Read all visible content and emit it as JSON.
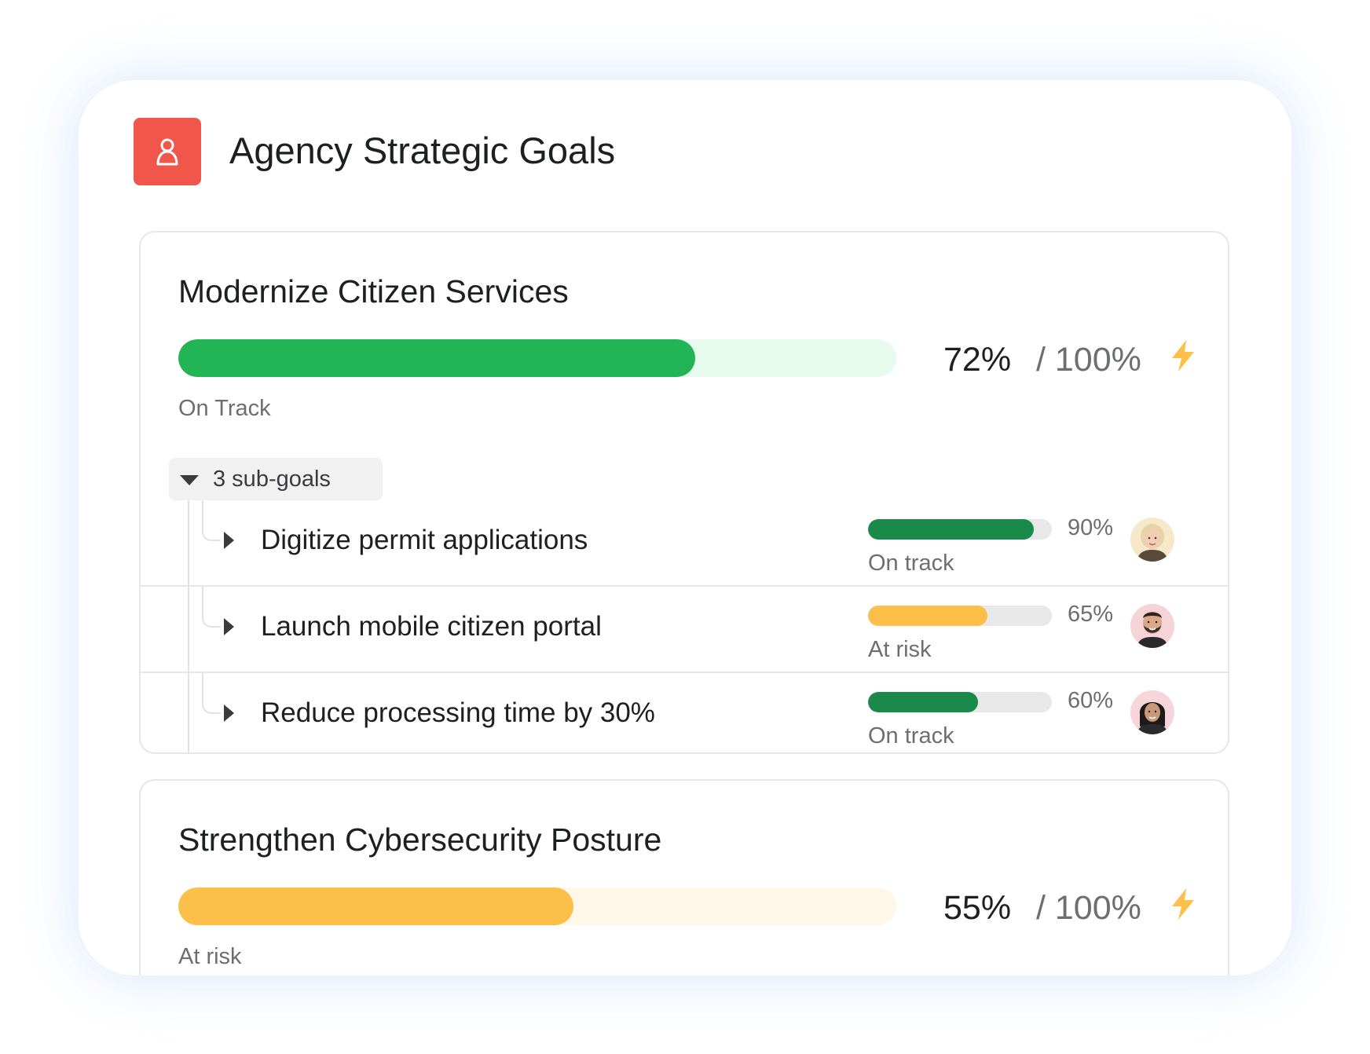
{
  "app": {
    "title": "Agency Strategic Goals",
    "icon": "goal-person-icon",
    "icon_color": "#f0574a"
  },
  "colors": {
    "on_track": "#22b455",
    "on_track_dark": "#1a8a4a",
    "at_risk": "#fcc04a",
    "bolt": "#fcc04a"
  },
  "goals": [
    {
      "title": "Modernize Citizen Services",
      "progress": 72,
      "percent_label": "72%",
      "total_label": "/ 100%",
      "status": "On Track",
      "bar_color": "#22b455",
      "track_color": "#e6fbee",
      "icon": "lightning-bolt-icon",
      "subgoal_toggle": "3 sub-goals",
      "subgoals": [
        {
          "title": "Digitize permit applications",
          "progress": 90,
          "percent_label": "90%",
          "status": "On track",
          "bar_color": "#1a8a4a",
          "avatar": "avatar-woman-blonde"
        },
        {
          "title": "Launch mobile citizen portal",
          "progress": 65,
          "percent_label": "65%",
          "status": "At risk",
          "bar_color": "#fcc04a",
          "avatar": "avatar-man-beard"
        },
        {
          "title": "Reduce processing time by 30%",
          "progress": 60,
          "percent_label": "60%",
          "status": "On track",
          "bar_color": "#1a8a4a",
          "avatar": "avatar-woman-dark-hair"
        }
      ]
    },
    {
      "title": "Strengthen Cybersecurity Posture",
      "progress": 55,
      "percent_label": "55%",
      "total_label": "/ 100%",
      "status": "At risk",
      "bar_color": "#fcc04a",
      "track_color": "#fff8e8",
      "icon": "lightning-bolt-icon"
    }
  ]
}
